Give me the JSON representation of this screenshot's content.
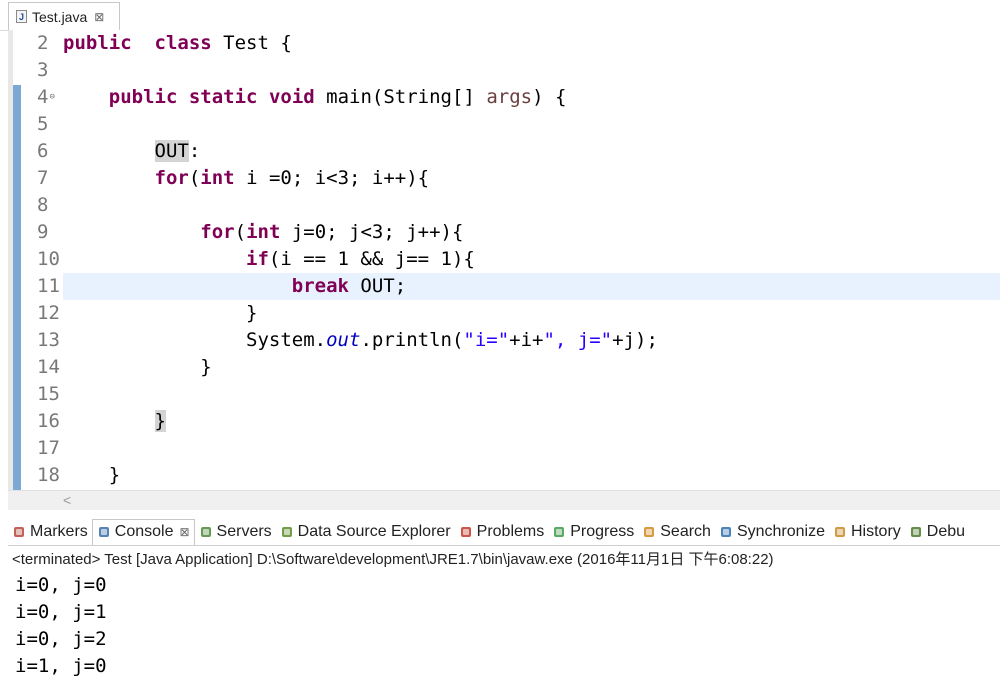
{
  "editor": {
    "tab": {
      "label": "Test.java",
      "close": "⊠"
    },
    "lines": [
      {
        "num": "2",
        "parts": [
          [
            "kw",
            "public"
          ],
          [
            "",
            "  "
          ],
          [
            "kw",
            "class"
          ],
          [
            "",
            " Test {"
          ]
        ]
      },
      {
        "num": "3",
        "parts": []
      },
      {
        "num": "4",
        "fold": true,
        "parts": [
          [
            "",
            "    "
          ],
          [
            "kw",
            "public"
          ],
          [
            "",
            " "
          ],
          [
            "kw",
            "static"
          ],
          [
            "",
            " "
          ],
          [
            "kw",
            "void"
          ],
          [
            "",
            " main(String[] "
          ],
          [
            "var",
            "args"
          ],
          [
            "",
            ") {"
          ]
        ]
      },
      {
        "num": "5",
        "parts": []
      },
      {
        "num": "6",
        "parts": [
          [
            "",
            "        "
          ],
          [
            "lbl",
            "OUT"
          ],
          [
            "",
            ":"
          ]
        ]
      },
      {
        "num": "7",
        "parts": [
          [
            "",
            "        "
          ],
          [
            "kw",
            "for"
          ],
          [
            "",
            "("
          ],
          [
            "kw",
            "int"
          ],
          [
            "",
            " i =0; i<3; i++){"
          ]
        ]
      },
      {
        "num": "8",
        "parts": []
      },
      {
        "num": "9",
        "parts": [
          [
            "",
            "            "
          ],
          [
            "kw",
            "for"
          ],
          [
            "",
            "("
          ],
          [
            "kw",
            "int"
          ],
          [
            "",
            " j=0; j<3; j++){"
          ]
        ]
      },
      {
        "num": "10",
        "parts": [
          [
            "",
            "                "
          ],
          [
            "kw",
            "if"
          ],
          [
            "",
            "(i == 1 && j== 1){"
          ]
        ]
      },
      {
        "num": "11",
        "current": true,
        "parts": [
          [
            "",
            "                    "
          ],
          [
            "kw",
            "break"
          ],
          [
            "",
            " OUT;"
          ]
        ]
      },
      {
        "num": "12",
        "parts": [
          [
            "",
            "                }"
          ]
        ]
      },
      {
        "num": "13",
        "parts": [
          [
            "",
            "                System."
          ],
          [
            "fld",
            "out"
          ],
          [
            "",
            ".println("
          ],
          [
            "str",
            "\"i=\""
          ],
          [
            "",
            "+i+"
          ],
          [
            "str",
            "\", j=\""
          ],
          [
            "",
            "+j);"
          ]
        ]
      },
      {
        "num": "14",
        "parts": [
          [
            "",
            "            }"
          ]
        ]
      },
      {
        "num": "15",
        "parts": []
      },
      {
        "num": "16",
        "parts": [
          [
            "",
            "        "
          ],
          [
            "lbl",
            "}"
          ]
        ]
      },
      {
        "num": "17",
        "parts": []
      },
      {
        "num": "18",
        "parts": [
          [
            "",
            "    }"
          ]
        ]
      }
    ],
    "scroll_arrow": "<"
  },
  "views": {
    "tabs": [
      {
        "label": "Markers",
        "icon": "markers-icon",
        "color": "#b5473a"
      },
      {
        "label": "Console",
        "icon": "console-icon",
        "color": "#3b6ea8",
        "active": true
      },
      {
        "label": "Servers",
        "icon": "servers-icon",
        "color": "#4a8a3a"
      },
      {
        "label": "Data Source Explorer",
        "icon": "data-source-icon",
        "color": "#5a8c2a"
      },
      {
        "label": "Problems",
        "icon": "problems-icon",
        "color": "#c0392b"
      },
      {
        "label": "Progress",
        "icon": "progress-icon",
        "color": "#3d9a4a"
      },
      {
        "label": "Search",
        "icon": "search-icon",
        "color": "#d08a20"
      },
      {
        "label": "Synchronize",
        "icon": "synchronize-icon",
        "color": "#2f6fb0"
      },
      {
        "label": "History",
        "icon": "history-icon",
        "color": "#c88a2a"
      },
      {
        "label": "Debu",
        "icon": "debug-icon",
        "color": "#4a7a2a"
      }
    ],
    "close": "⊠"
  },
  "console": {
    "header": "<terminated> Test [Java Application] D:\\Software\\development\\JRE1.7\\bin\\javaw.exe (2016年11月1日 下午6:08:22)",
    "output": [
      "i=0, j=0",
      "i=0, j=1",
      "i=0, j=2",
      "i=1, j=0"
    ]
  }
}
